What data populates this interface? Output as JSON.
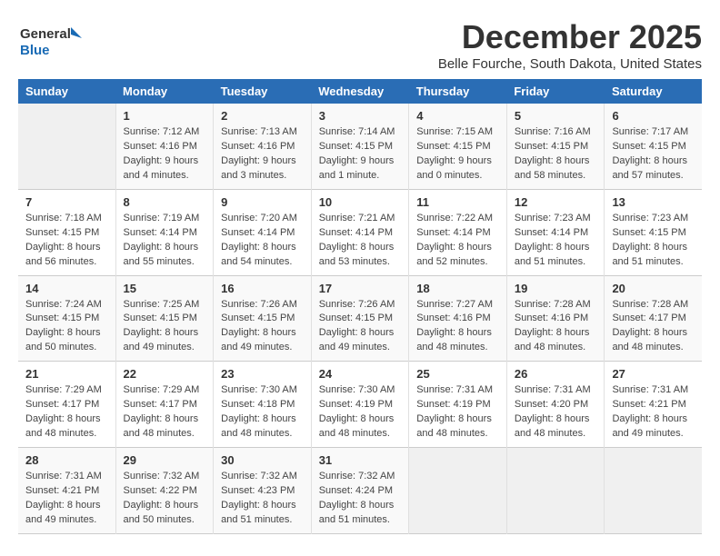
{
  "logo": {
    "line1": "General",
    "line2": "Blue"
  },
  "title": "December 2025",
  "subtitle": "Belle Fourche, South Dakota, United States",
  "days_header": [
    "Sunday",
    "Monday",
    "Tuesday",
    "Wednesday",
    "Thursday",
    "Friday",
    "Saturday"
  ],
  "weeks": [
    [
      {
        "day": "",
        "content": ""
      },
      {
        "day": "1",
        "content": "Sunrise: 7:12 AM\nSunset: 4:16 PM\nDaylight: 9 hours\nand 4 minutes."
      },
      {
        "day": "2",
        "content": "Sunrise: 7:13 AM\nSunset: 4:16 PM\nDaylight: 9 hours\nand 3 minutes."
      },
      {
        "day": "3",
        "content": "Sunrise: 7:14 AM\nSunset: 4:15 PM\nDaylight: 9 hours\nand 1 minute."
      },
      {
        "day": "4",
        "content": "Sunrise: 7:15 AM\nSunset: 4:15 PM\nDaylight: 9 hours\nand 0 minutes."
      },
      {
        "day": "5",
        "content": "Sunrise: 7:16 AM\nSunset: 4:15 PM\nDaylight: 8 hours\nand 58 minutes."
      },
      {
        "day": "6",
        "content": "Sunrise: 7:17 AM\nSunset: 4:15 PM\nDaylight: 8 hours\nand 57 minutes."
      }
    ],
    [
      {
        "day": "7",
        "content": "Sunrise: 7:18 AM\nSunset: 4:15 PM\nDaylight: 8 hours\nand 56 minutes."
      },
      {
        "day": "8",
        "content": "Sunrise: 7:19 AM\nSunset: 4:14 PM\nDaylight: 8 hours\nand 55 minutes."
      },
      {
        "day": "9",
        "content": "Sunrise: 7:20 AM\nSunset: 4:14 PM\nDaylight: 8 hours\nand 54 minutes."
      },
      {
        "day": "10",
        "content": "Sunrise: 7:21 AM\nSunset: 4:14 PM\nDaylight: 8 hours\nand 53 minutes."
      },
      {
        "day": "11",
        "content": "Sunrise: 7:22 AM\nSunset: 4:14 PM\nDaylight: 8 hours\nand 52 minutes."
      },
      {
        "day": "12",
        "content": "Sunrise: 7:23 AM\nSunset: 4:14 PM\nDaylight: 8 hours\nand 51 minutes."
      },
      {
        "day": "13",
        "content": "Sunrise: 7:23 AM\nSunset: 4:15 PM\nDaylight: 8 hours\nand 51 minutes."
      }
    ],
    [
      {
        "day": "14",
        "content": "Sunrise: 7:24 AM\nSunset: 4:15 PM\nDaylight: 8 hours\nand 50 minutes."
      },
      {
        "day": "15",
        "content": "Sunrise: 7:25 AM\nSunset: 4:15 PM\nDaylight: 8 hours\nand 49 minutes."
      },
      {
        "day": "16",
        "content": "Sunrise: 7:26 AM\nSunset: 4:15 PM\nDaylight: 8 hours\nand 49 minutes."
      },
      {
        "day": "17",
        "content": "Sunrise: 7:26 AM\nSunset: 4:15 PM\nDaylight: 8 hours\nand 49 minutes."
      },
      {
        "day": "18",
        "content": "Sunrise: 7:27 AM\nSunset: 4:16 PM\nDaylight: 8 hours\nand 48 minutes."
      },
      {
        "day": "19",
        "content": "Sunrise: 7:28 AM\nSunset: 4:16 PM\nDaylight: 8 hours\nand 48 minutes."
      },
      {
        "day": "20",
        "content": "Sunrise: 7:28 AM\nSunset: 4:17 PM\nDaylight: 8 hours\nand 48 minutes."
      }
    ],
    [
      {
        "day": "21",
        "content": "Sunrise: 7:29 AM\nSunset: 4:17 PM\nDaylight: 8 hours\nand 48 minutes."
      },
      {
        "day": "22",
        "content": "Sunrise: 7:29 AM\nSunset: 4:17 PM\nDaylight: 8 hours\nand 48 minutes."
      },
      {
        "day": "23",
        "content": "Sunrise: 7:30 AM\nSunset: 4:18 PM\nDaylight: 8 hours\nand 48 minutes."
      },
      {
        "day": "24",
        "content": "Sunrise: 7:30 AM\nSunset: 4:19 PM\nDaylight: 8 hours\nand 48 minutes."
      },
      {
        "day": "25",
        "content": "Sunrise: 7:31 AM\nSunset: 4:19 PM\nDaylight: 8 hours\nand 48 minutes."
      },
      {
        "day": "26",
        "content": "Sunrise: 7:31 AM\nSunset: 4:20 PM\nDaylight: 8 hours\nand 48 minutes."
      },
      {
        "day": "27",
        "content": "Sunrise: 7:31 AM\nSunset: 4:21 PM\nDaylight: 8 hours\nand 49 minutes."
      }
    ],
    [
      {
        "day": "28",
        "content": "Sunrise: 7:31 AM\nSunset: 4:21 PM\nDaylight: 8 hours\nand 49 minutes."
      },
      {
        "day": "29",
        "content": "Sunrise: 7:32 AM\nSunset: 4:22 PM\nDaylight: 8 hours\nand 50 minutes."
      },
      {
        "day": "30",
        "content": "Sunrise: 7:32 AM\nSunset: 4:23 PM\nDaylight: 8 hours\nand 51 minutes."
      },
      {
        "day": "31",
        "content": "Sunrise: 7:32 AM\nSunset: 4:24 PM\nDaylight: 8 hours\nand 51 minutes."
      },
      {
        "day": "",
        "content": ""
      },
      {
        "day": "",
        "content": ""
      },
      {
        "day": "",
        "content": ""
      }
    ]
  ]
}
